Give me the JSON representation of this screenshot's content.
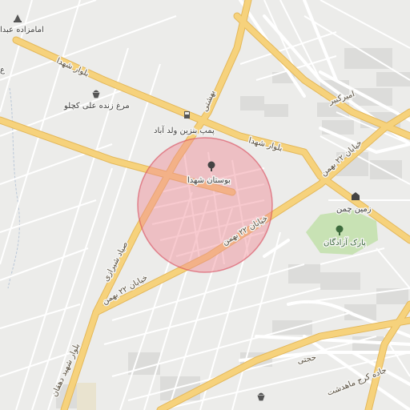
{
  "map": {
    "roads": {
      "blvd_shohada_top": "بلوار شهدا",
      "blvd_shohada_right": "بلوار شهدا",
      "beheshti": "بهشتی",
      "amirkabir": "امیرکبیر",
      "khiaban_22_bahman_ne": "خیابان ۲۲ بهمن",
      "khiaban_22_bahman_center": "خیابان ۲۲ بهمن",
      "khiaban_22_bahman_sw": "خیابان ۲۲ بهمن",
      "sayyad_shirazi": "صیاد شیرازی",
      "blvd_shahid_dehghan": "بلوار شهید دهقان",
      "hojjati": "حجتی",
      "karaj_mahdasht": "جاده کرج ماهدشت"
    },
    "pois": {
      "imamzadeh": "امامزاده عبدا",
      "morgh": "مرغ زنده علی کچلو",
      "gas_station": "پمپ بنزین ولد آباد",
      "bostan": "بوستان شهدا",
      "zamin_chaman": "زمین چمن",
      "azadegan_park": "پارک آزادگان"
    },
    "edge_fragment": "ع"
  },
  "colors": {
    "background": "#ececea",
    "road_major": "#f6d27c",
    "road_major_casing": "#e4b85a",
    "road_minor": "#ffffff",
    "highlight_fill": "#f08a95",
    "highlight_stroke": "#d94a5a",
    "park": "#c8e2b4",
    "block": "#dcdcda"
  },
  "icons": [
    "shrine-icon",
    "shopping-basket-icon",
    "fuel-icon",
    "tree-icon",
    "stadium-icon"
  ]
}
